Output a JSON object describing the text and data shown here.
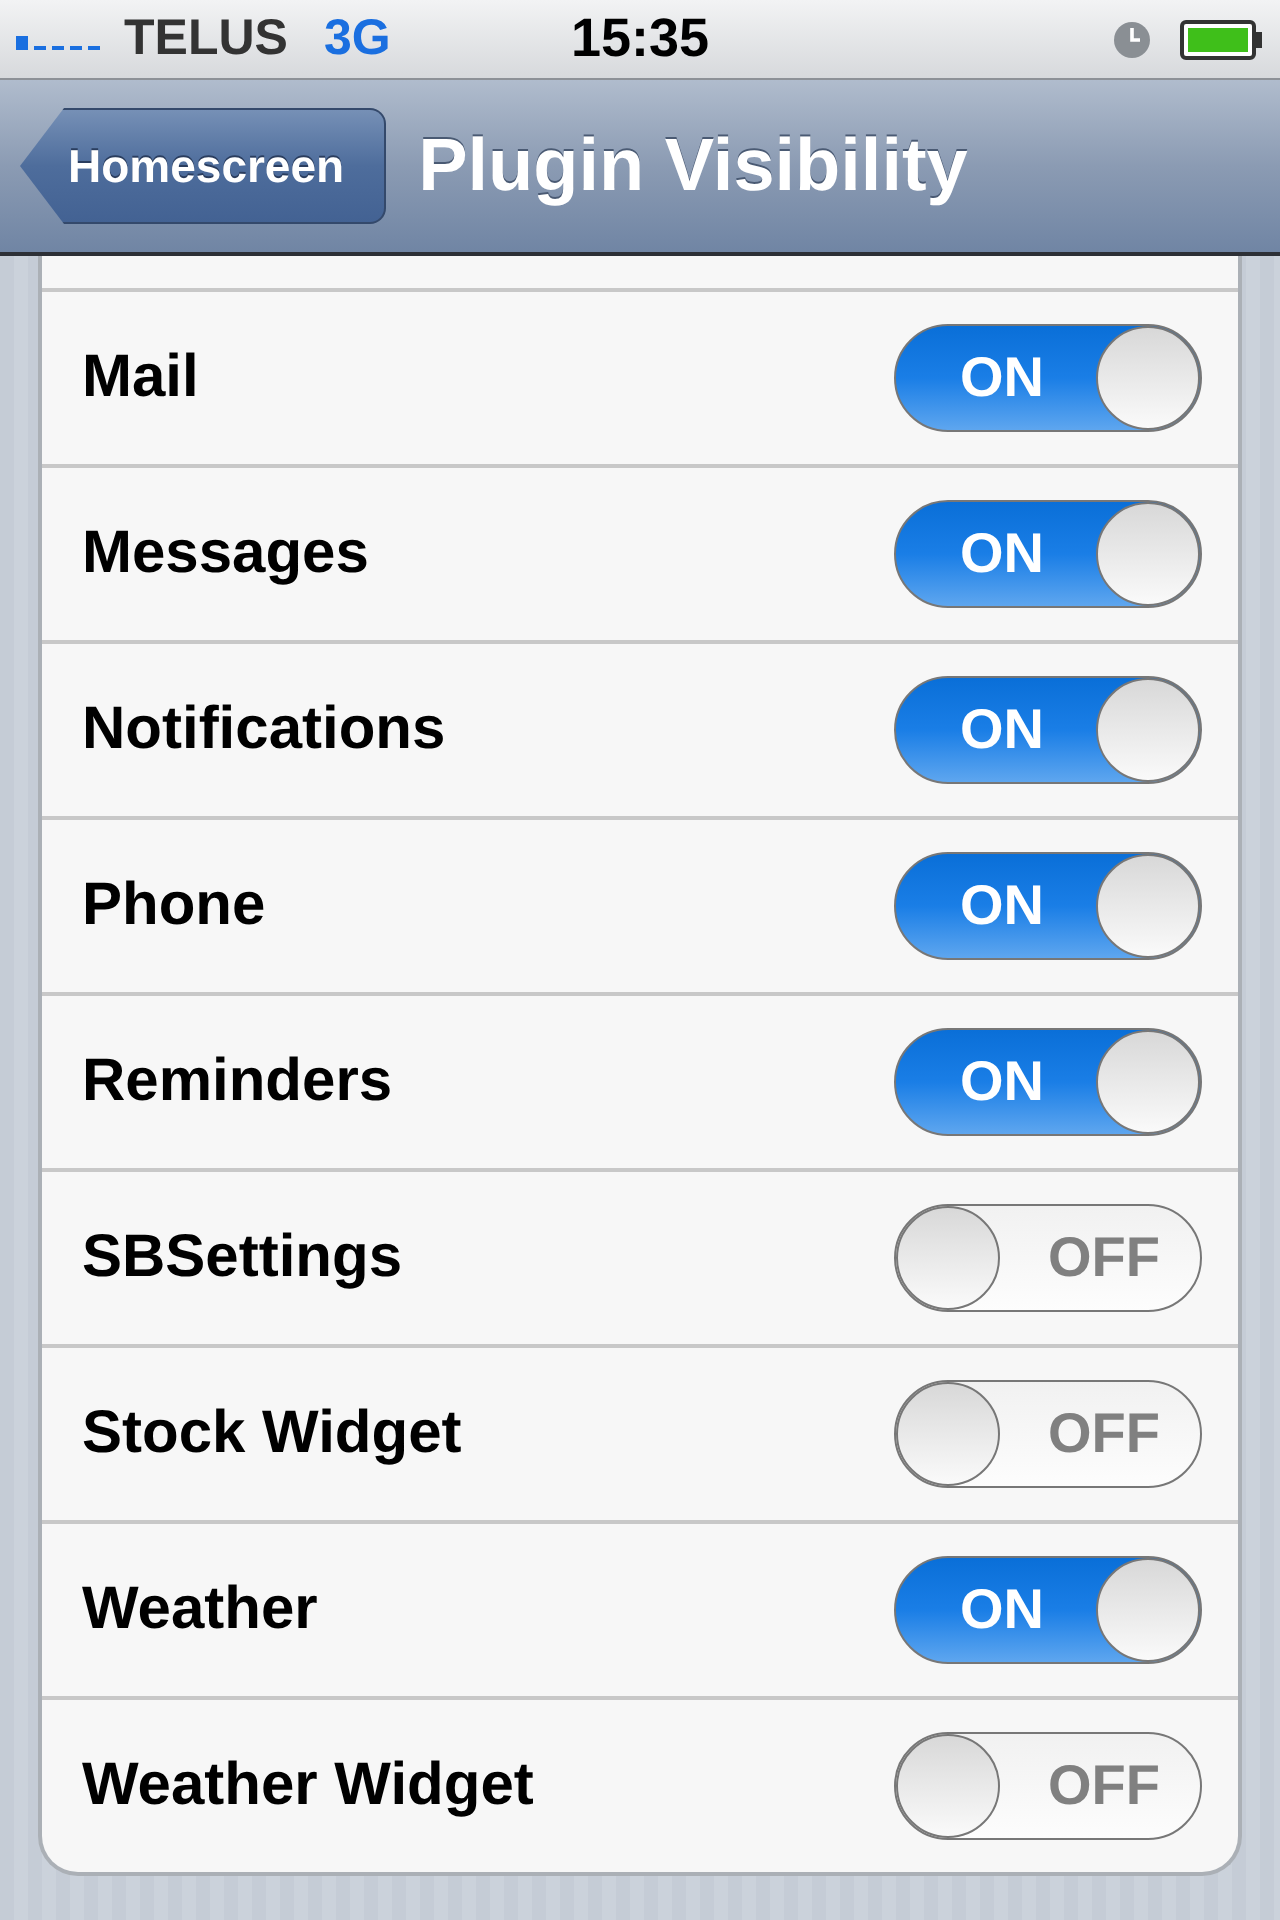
{
  "status_bar": {
    "carrier": "TELUS",
    "network": "3G",
    "time": "15:35"
  },
  "nav": {
    "back": "Homescreen",
    "title": "Plugin Visibility"
  },
  "rows": [
    {
      "label": "Mail",
      "on": true,
      "switch_text": "ON"
    },
    {
      "label": "Messages",
      "on": true,
      "switch_text": "ON"
    },
    {
      "label": "Notifications",
      "on": true,
      "switch_text": "ON"
    },
    {
      "label": "Phone",
      "on": true,
      "switch_text": "ON"
    },
    {
      "label": "Reminders",
      "on": true,
      "switch_text": "ON"
    },
    {
      "label": "SBSettings",
      "on": false,
      "switch_text": "OFF"
    },
    {
      "label": "Stock Widget",
      "on": false,
      "switch_text": "OFF"
    },
    {
      "label": "Weather",
      "on": true,
      "switch_text": "ON"
    },
    {
      "label": "Weather Widget",
      "on": false,
      "switch_text": "OFF"
    }
  ]
}
